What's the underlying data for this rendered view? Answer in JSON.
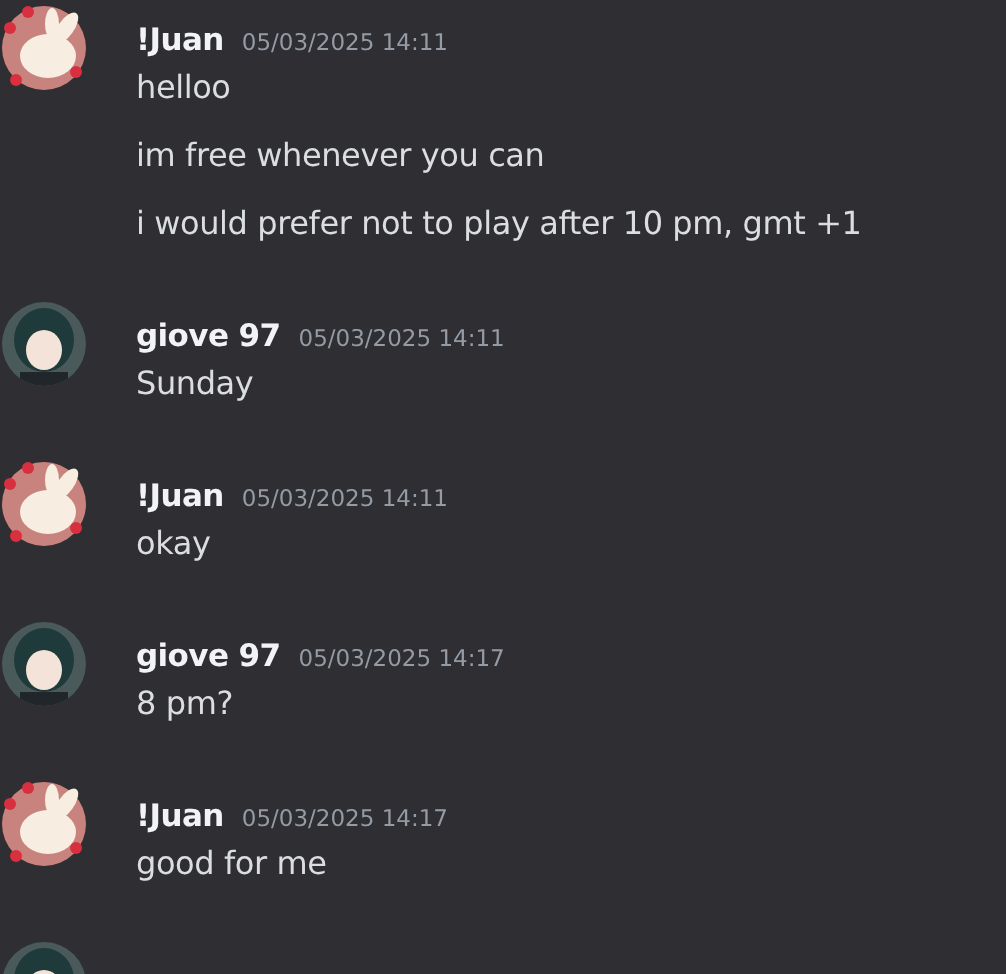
{
  "messages": [
    {
      "author": "!Juan",
      "timestamp": "05/03/2025 14:11",
      "kind": "bunny",
      "lines": [
        "helloo",
        "im free whenever you can",
        "i would prefer not to play after 10 pm, gmt +1"
      ]
    },
    {
      "author": "giove 97",
      "timestamp": "05/03/2025 14:11",
      "kind": "figure",
      "lines": [
        "Sunday"
      ]
    },
    {
      "author": "!Juan",
      "timestamp": "05/03/2025 14:11",
      "kind": "bunny",
      "lines": [
        "okay"
      ]
    },
    {
      "author": "giove 97",
      "timestamp": "05/03/2025 14:17",
      "kind": "figure",
      "lines": [
        "8 pm?"
      ]
    },
    {
      "author": "!Juan",
      "timestamp": "05/03/2025 14:17",
      "kind": "bunny",
      "lines": [
        "good for me"
      ]
    },
    {
      "kind": "figure"
    }
  ]
}
